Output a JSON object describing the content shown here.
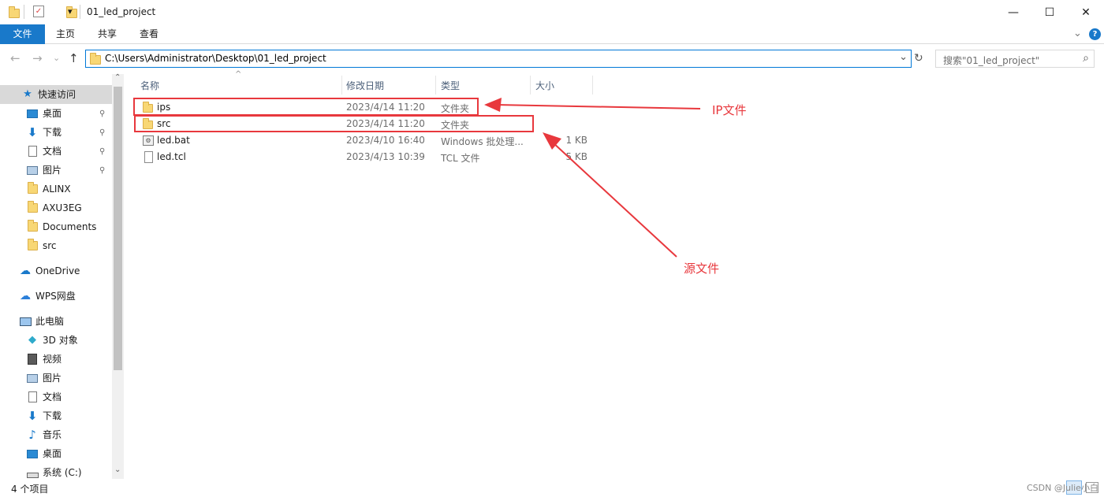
{
  "window": {
    "title": "01_led_project",
    "minimize_glyph": "—",
    "maximize_glyph": "☐",
    "close_glyph": "✕",
    "qa_dropdown_glyph": "▾"
  },
  "ribbon": {
    "tabs": [
      "文件",
      "主页",
      "共享",
      "查看"
    ],
    "expand_glyph": "⌄",
    "help_glyph": "?"
  },
  "nav": {
    "back_glyph": "←",
    "forward_glyph": "→",
    "recent_glyph": "⌄",
    "up_glyph": "↑",
    "address": "C:\\Users\\Administrator\\Desktop\\01_led_project",
    "address_dropdown_glyph": "⌄",
    "refresh_glyph": "↻",
    "search_placeholder": "搜索\"01_led_project\"",
    "search_icon_glyph": "⌕"
  },
  "sidebar": {
    "quick_access": "快速访问",
    "quick_items": [
      "桌面",
      "下载",
      "文档",
      "图片",
      "ALINX",
      "AXU3EG",
      "Documents",
      "src"
    ],
    "onedrive": "OneDrive",
    "wps": "WPS网盘",
    "this_pc": "此电脑",
    "pc_items": [
      "3D 对象",
      "视频",
      "图片",
      "文档",
      "下载",
      "音乐",
      "桌面",
      "系统 (C:)"
    ],
    "pin_glyph": "📌",
    "scroll_up_glyph": "⌃",
    "scroll_down_glyph": "⌄"
  },
  "columns": {
    "name": "名称",
    "date": "修改日期",
    "type": "类型",
    "size": "大小",
    "sort_glyph": "^"
  },
  "files": [
    {
      "name": "ips",
      "date": "2023/4/14 11:20",
      "type": "文件夹",
      "size": "",
      "icon": "folder-icon"
    },
    {
      "name": "src",
      "date": "2023/4/14 11:20",
      "type": "文件夹",
      "size": "",
      "icon": "folder-icon"
    },
    {
      "name": "led.bat",
      "date": "2023/4/10 16:40",
      "type": "Windows 批处理...",
      "size": "1 KB",
      "icon": "batch-file-icon"
    },
    {
      "name": "led.tcl",
      "date": "2023/4/13 10:39",
      "type": "TCL 文件",
      "size": "5 KB",
      "icon": "text-file-icon"
    }
  ],
  "status": {
    "count": "4 个项目"
  },
  "annotations": {
    "ip_label": "IP文件",
    "src_label": "源文件",
    "color": "#e8383d"
  },
  "watermark": "CSDN @Julie小白"
}
